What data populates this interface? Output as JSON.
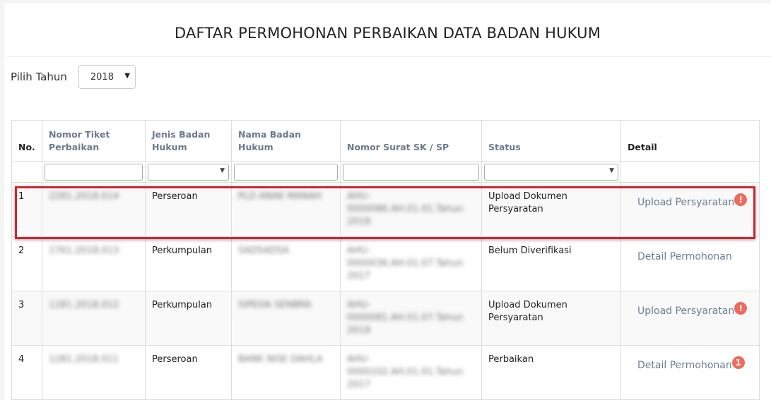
{
  "header": {
    "title": "DAFTAR PERMOHONAN PERBAIKAN DATA BADAN HUKUM"
  },
  "year_filter": {
    "label": "Pilih Tahun",
    "selected": "2018"
  },
  "table": {
    "columns": [
      "No.",
      "Nomor Tiket Perbaikan",
      "Jenis Badan Hukum",
      "Nama Badan Hukum",
      "Nomor Surat SK / SP",
      "Status",
      "Detail"
    ],
    "rows": [
      {
        "no": "1",
        "ticket": "2281.2018.014",
        "type": "Perseroan",
        "name": "PLD ANAK MANAH",
        "sk": "AHU-0000086.AH.01.01.Tahun 2018",
        "status": "Upload Dokumen Persyaratan",
        "detail": "Upload Persyaratan",
        "badge": "!"
      },
      {
        "no": "2",
        "ticket": "1761.2018.013",
        "type": "Perkumpulan",
        "name": "SADSADSA",
        "sk": "AHU-0000036.AH.01.07.Tahun 2017",
        "status": "Belum Diverifikasi",
        "detail": "Detail Permohonan",
        "badge": ""
      },
      {
        "no": "3",
        "ticket": "1281.2018.012",
        "type": "Perkumpulan",
        "name": "SIPEDA SENBRA",
        "sk": "AHU-0000081.AH.01.07.Tahun 2018",
        "status": "Upload Dokumen Persyaratan",
        "detail": "Upload Persyaratan",
        "badge": "!"
      },
      {
        "no": "4",
        "ticket": "1281.2018.011",
        "type": "Perseroan",
        "name": "BANK NISE DAHLA",
        "sk": "AHU-0000102.AH.01.01.Tahun 2017",
        "status": "Perbaikan",
        "detail": "Detail Permohonan",
        "badge": "1"
      }
    ]
  },
  "colors": {
    "highlight": "#d0242d",
    "badge": "#ef6b5b",
    "link": "#6b7f91",
    "header_text": "#6b7a8f"
  }
}
